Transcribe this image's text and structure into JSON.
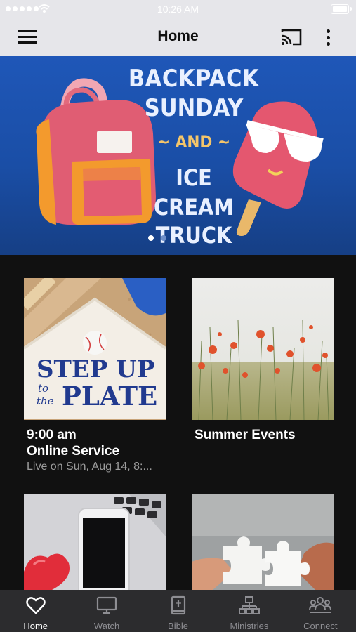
{
  "status_bar": {
    "time": "10:26 AM"
  },
  "header": {
    "title": "Home"
  },
  "banner": {
    "line1": "BACKPACK",
    "line2": "SUNDAY",
    "line3": "~ AND ~",
    "line4": "ICE",
    "line5": "CREAM",
    "line6": "TRUCK",
    "page_count": 2,
    "active_page": 1
  },
  "cards": [
    {
      "image_text_1": "STEP UP",
      "image_text_2": "to",
      "image_text_3": "the",
      "image_text_4": "PLATE",
      "time": "9:00 am",
      "title": "Online Service",
      "subtitle": "Live on Sun, Aug 14, 8:..."
    },
    {
      "title": "Summer Events"
    },
    {
      "image": "phone-heart-laptop"
    },
    {
      "image": "puzzle-hands"
    }
  ],
  "tabs": [
    {
      "label": "Home",
      "icon": "heart-icon",
      "active": true
    },
    {
      "label": "Watch",
      "icon": "tv-icon"
    },
    {
      "label": "Bible",
      "icon": "bible-icon"
    },
    {
      "label": "Ministries",
      "icon": "org-chart-icon"
    },
    {
      "label": "Connect",
      "icon": "people-icon"
    }
  ],
  "colors": {
    "header_bg": "#e6e6ea",
    "banner_blue": "#1f57b8",
    "tabbar_bg": "#2c2c2e",
    "app_bg": "#111111"
  }
}
